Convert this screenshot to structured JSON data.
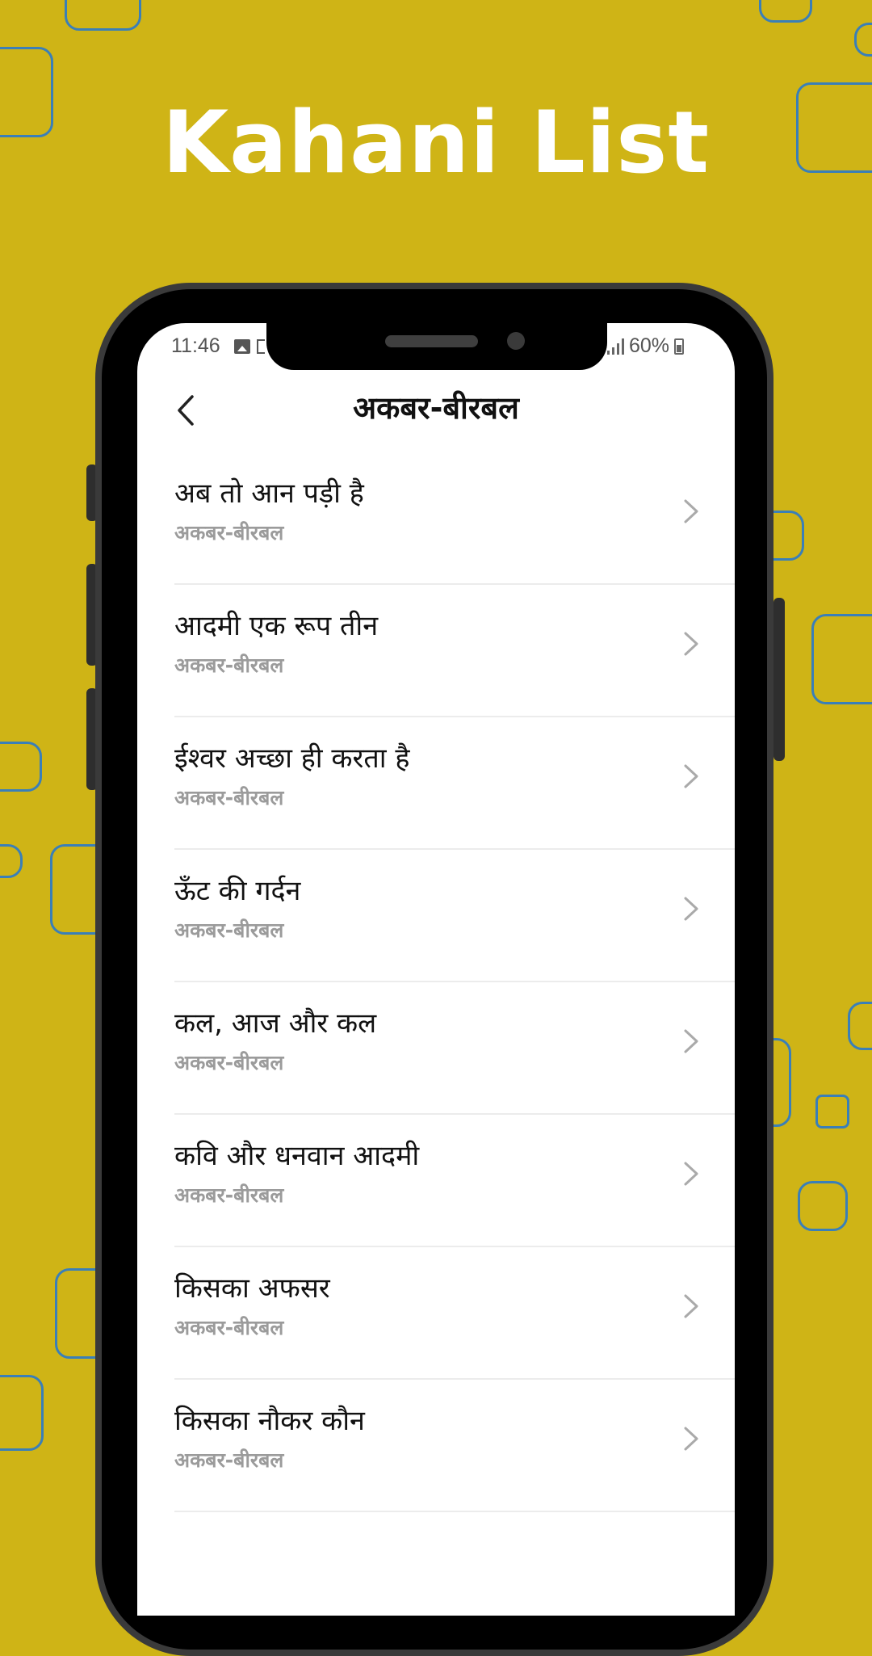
{
  "promo": {
    "title": "Kahani List"
  },
  "status_bar": {
    "time": "11:46",
    "battery": "60%"
  },
  "header": {
    "title": "अकबर-बीरबल"
  },
  "stories": [
    {
      "title": "अब तो आन पड़ी है",
      "category": "अकबर-बीरबल"
    },
    {
      "title": "आदमी एक रूप तीन",
      "category": "अकबर-बीरबल"
    },
    {
      "title": "ईश्वर अच्छा ही करता है",
      "category": "अकबर-बीरबल"
    },
    {
      "title": "ऊँट की गर्दन",
      "category": "अकबर-बीरबल"
    },
    {
      "title": "कल, आज और कल",
      "category": "अकबर-बीरबल"
    },
    {
      "title": "कवि और धनवान आदमी",
      "category": "अकबर-बीरबल"
    },
    {
      "title": "किसका अफसर",
      "category": "अकबर-बीरबल"
    },
    {
      "title": "किसका नौकर कौन",
      "category": "अकबर-बीरबल"
    }
  ],
  "colors": {
    "background": "#CFB416",
    "decor_outline": "#3A7FB8",
    "text_primary": "#111111",
    "text_secondary": "#9B9B9B"
  },
  "icons": {
    "back": "chevron-left-icon",
    "row": "chevron-right-icon"
  }
}
